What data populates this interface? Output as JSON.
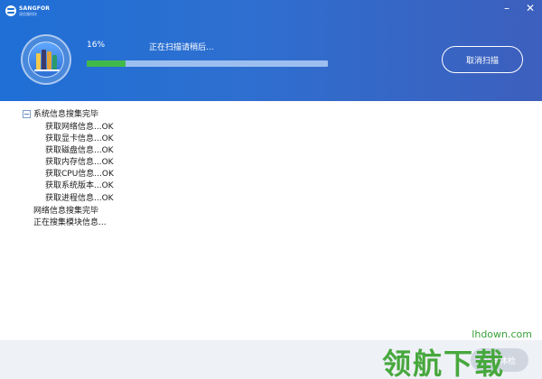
{
  "brand": {
    "name": "SANGFOR",
    "sub": "深信服科技"
  },
  "window": {
    "minimize": "–",
    "close": "✕"
  },
  "scan": {
    "percent_label": "16%",
    "progress": 0.16,
    "status": "正在扫描请稍后...",
    "cancel_label": "取消扫描"
  },
  "log": {
    "items": [
      "系统信息搜集完毕",
      "获取网络信息...OK",
      "获取显卡信息...OK",
      "获取磁盘信息...OK",
      "获取内存信息...OK",
      "获取CPU信息...OK",
      "获取系统版本...OK",
      "获取进程信息...OK",
      "网络信息搜集完毕",
      "正在搜集模块信息..."
    ]
  },
  "footer": {
    "start_label": "开始体检"
  },
  "watermark": {
    "url": "lhdown.com",
    "logo": "领航下载"
  },
  "colors": {
    "header": "#2e6fd0",
    "progress_fill": "#41b94a",
    "progress_track": "#9dbff0"
  }
}
